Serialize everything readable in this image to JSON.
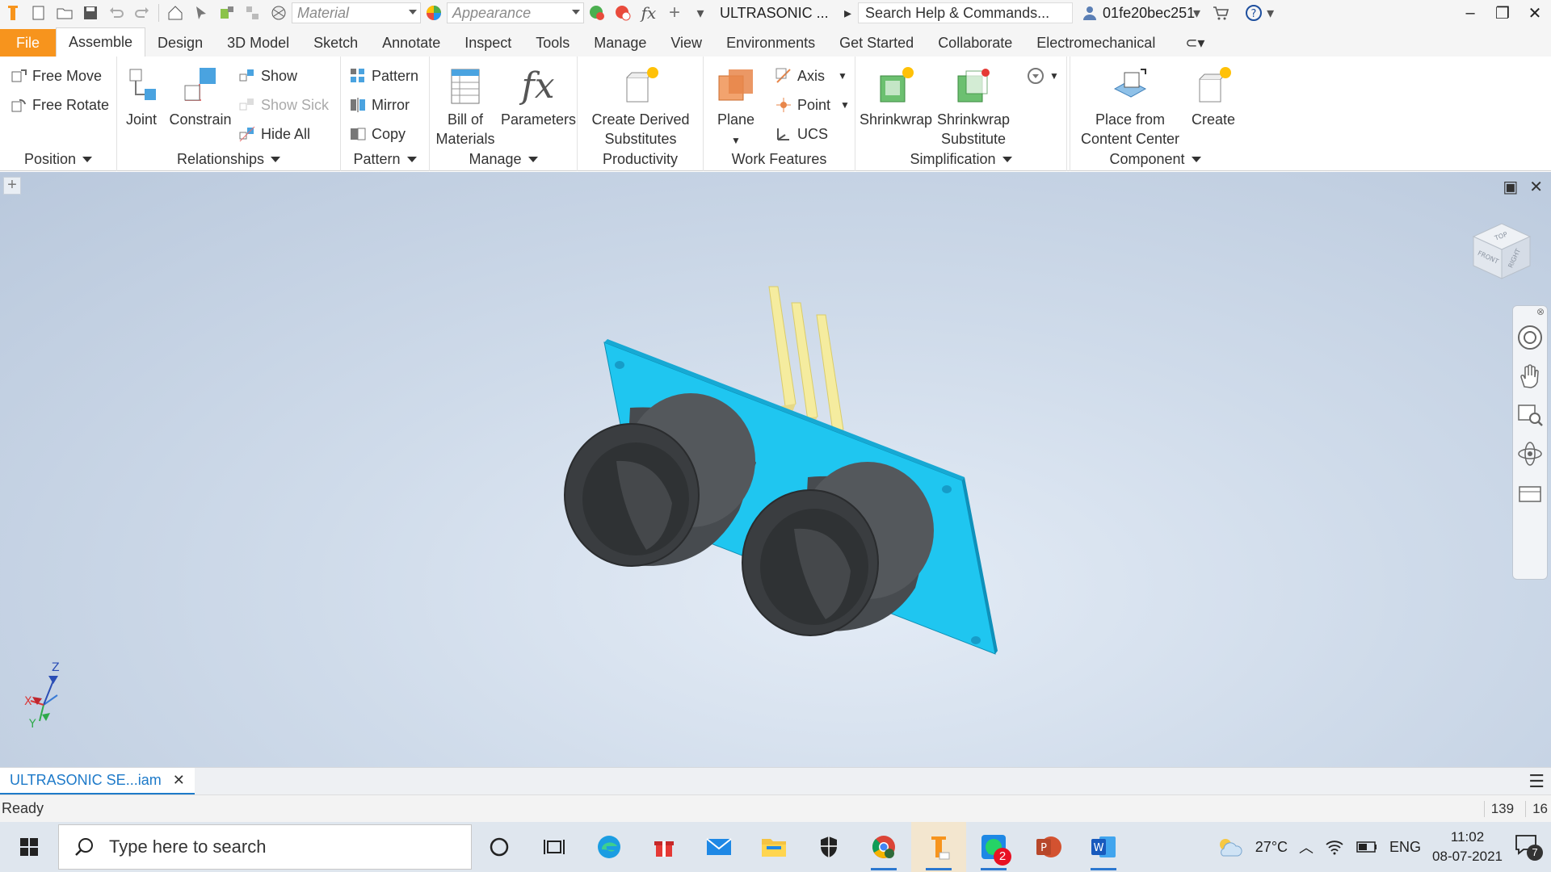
{
  "titlebar": {
    "material_placeholder": "Material",
    "appearance_placeholder": "Appearance",
    "doc_title": "ULTRASONIC ...",
    "search_placeholder": "Search Help & Commands...",
    "user": "01fe20bec251"
  },
  "ribbon_tabs": [
    "File",
    "Assemble",
    "Design",
    "3D Model",
    "Sketch",
    "Annotate",
    "Inspect",
    "Tools",
    "Manage",
    "View",
    "Environments",
    "Get Started",
    "Collaborate",
    "Electromechanical"
  ],
  "active_tab": "Assemble",
  "ribbon": {
    "position": {
      "label": "Position",
      "free_move": "Free Move",
      "free_rotate": "Free Rotate"
    },
    "relationships": {
      "label": "Relationships",
      "joint": "Joint",
      "constrain": "Constrain",
      "show": "Show",
      "show_sick": "Show Sick",
      "hide_all": "Hide All"
    },
    "pattern": {
      "label": "Pattern",
      "pattern": "Pattern",
      "mirror": "Mirror",
      "copy": "Copy"
    },
    "manage": {
      "label": "Manage",
      "bom_line1": "Bill of",
      "bom_line2": "Materials",
      "parameters": "Parameters"
    },
    "productivity": {
      "label": "Productivity",
      "derived_line1": "Create Derived",
      "derived_line2": "Substitutes"
    },
    "work_features": {
      "label": "Work Features",
      "plane": "Plane",
      "axis": "Axis",
      "point": "Point",
      "ucs": "UCS"
    },
    "simplification": {
      "label": "Simplification",
      "shrinkwrap": "Shrinkwrap",
      "shrink_sub_line1": "Shrinkwrap",
      "shrink_sub_line2": "Substitute"
    },
    "component": {
      "label": "Component",
      "place_line1": "Place from",
      "place_line2": "Content Center",
      "create": "Create"
    }
  },
  "viewcube": {
    "front": "FRONT",
    "top": "TOP",
    "right": "RIGHT"
  },
  "triad": {
    "x": "X",
    "y": "Y",
    "z": "Z"
  },
  "doc_tab": "ULTRASONIC SE...iam",
  "status": {
    "text": "Ready",
    "count1": "139",
    "count2": "16"
  },
  "taskbar": {
    "search_placeholder": "Type here to search",
    "weather": "27°C",
    "lang": "ENG",
    "time": "11:02",
    "date": "08-07-2021",
    "chat_badge": "2",
    "notif_count": "7"
  },
  "colors": {
    "pcb": "#1fc6f0",
    "sensor": "#3a3d40",
    "pins": "#f3ea97",
    "accent": "#f7941d"
  }
}
